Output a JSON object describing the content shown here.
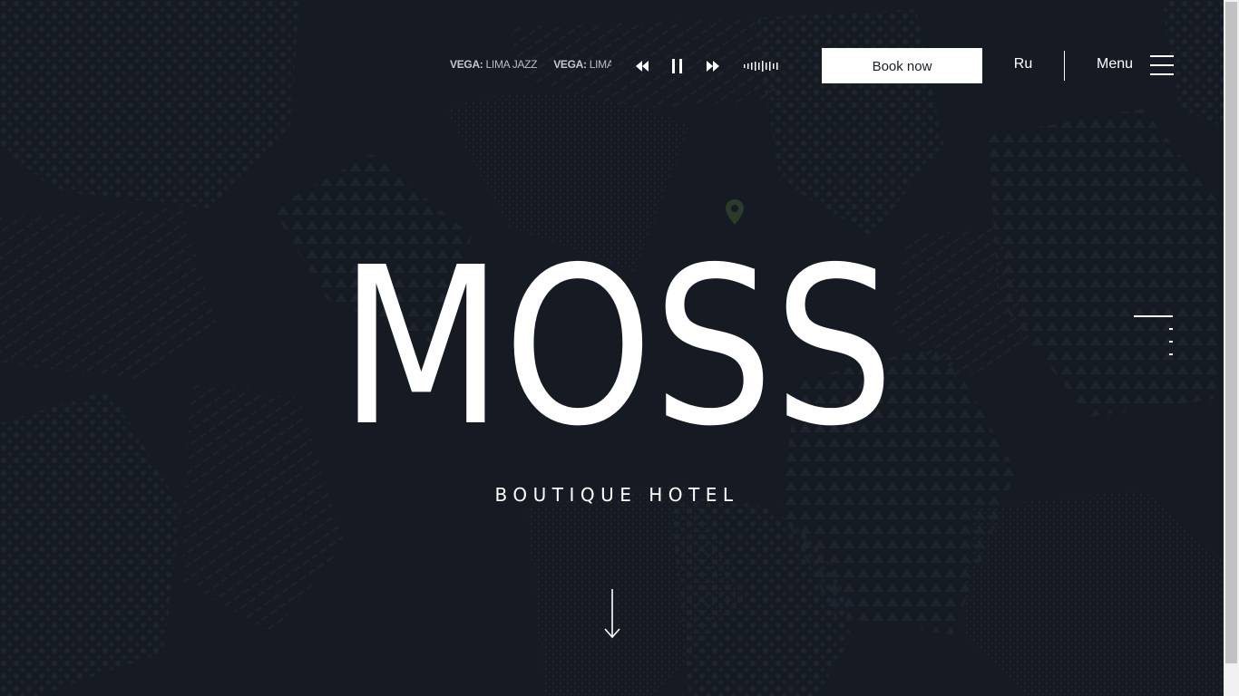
{
  "player": {
    "tracks": [
      {
        "artist": "VEGA:",
        "title": " LIMA JAZZ"
      },
      {
        "artist": "VEGA:",
        "title": " LIMA JAZZ"
      }
    ],
    "prev_icon": "rewind-icon",
    "pause_icon": "pause-icon",
    "next_icon": "fast-forward-icon",
    "equalizer_icon": "equalizer-icon"
  },
  "header": {
    "book_label": "Book now",
    "language_label": "Ru",
    "menu_label": "Menu",
    "menu_icon": "hamburger-icon"
  },
  "hero": {
    "logo_text": "MOSS",
    "subtitle": "BOUTIQUE HOTEL",
    "location_icon": "map-pin-icon",
    "scroll_icon": "arrow-down-icon"
  },
  "slide_nav": {
    "count": 4,
    "active_index": 0
  },
  "colors": {
    "background": "#161b23",
    "pattern": "#1f252e",
    "text": "#ffffff",
    "accent_pin": "#2c3a2c",
    "button_bg": "#ffffff",
    "button_text": "#1a1f27"
  }
}
